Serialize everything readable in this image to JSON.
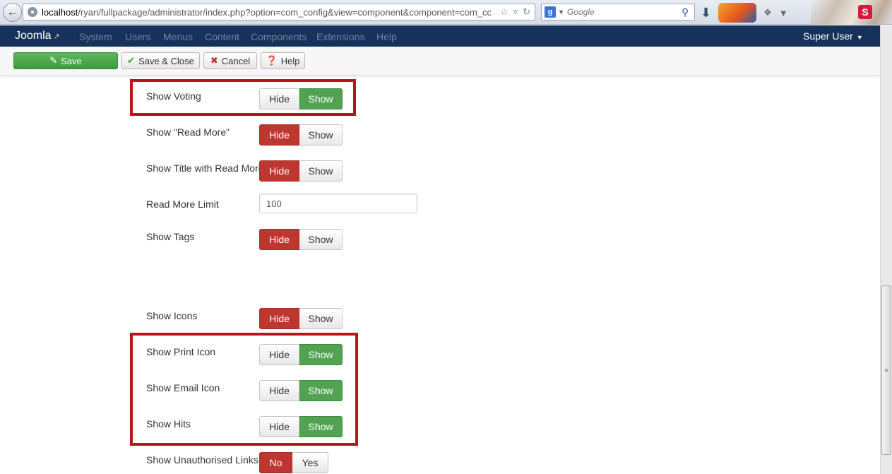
{
  "browser": {
    "url_host": "localhost",
    "url_rest": "/ryan/fullpackage/administrator/index.php?option=com_config&view=component&component=com_conten",
    "search_placeholder": "Google",
    "back_icon": "back-arrow-icon"
  },
  "navbar": {
    "brand": "Joomla",
    "items": [
      "System",
      "Users",
      "Menus",
      "Content",
      "Components",
      "Extensions",
      "Help"
    ],
    "user": "Super User"
  },
  "toolbar": {
    "save": "Save",
    "save_close": "Save & Close",
    "cancel": "Cancel",
    "help": "Help"
  },
  "rows": [
    {
      "label": "Show Voting",
      "off": "Hide",
      "on": "Show",
      "selected": "on"
    },
    {
      "label": "Show \"Read More\"",
      "off": "Hide",
      "on": "Show",
      "selected": "off"
    },
    {
      "label": "Show Title with Read More",
      "off": "Hide",
      "on": "Show",
      "selected": "off"
    },
    {
      "label": "Read More Limit",
      "value": "100"
    },
    {
      "label": "Show Tags",
      "off": "Hide",
      "on": "Show",
      "selected": "off"
    },
    {
      "label": "Show Icons",
      "off": "Hide",
      "on": "Show",
      "selected": "off"
    },
    {
      "label": "Show Print Icon",
      "off": "Hide",
      "on": "Show",
      "selected": "on"
    },
    {
      "label": "Show Email Icon",
      "off": "Hide",
      "on": "Show",
      "selected": "on"
    },
    {
      "label": "Show Hits",
      "off": "Hide",
      "on": "Show",
      "selected": "on"
    },
    {
      "label": "Show Unauthorised Links",
      "off": "No",
      "on": "Yes",
      "selected": "off"
    }
  ],
  "colors": {
    "navbar_bg": "#17325a",
    "toggle_red": "#bd362f",
    "toggle_green": "#51a351",
    "highlight": "#b8141d"
  }
}
